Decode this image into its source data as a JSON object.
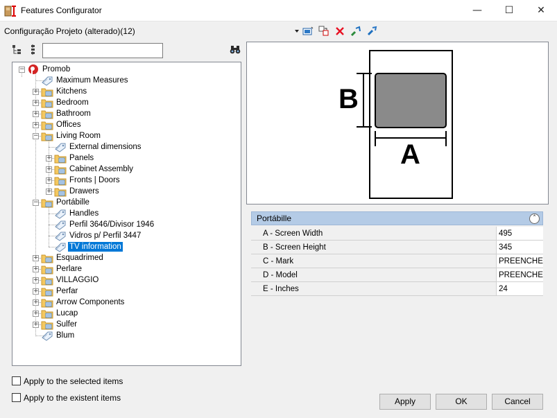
{
  "window": {
    "title": "Features Configurator",
    "minimize": "—",
    "maximize": "☐",
    "close": "✕"
  },
  "config": {
    "label": "Configuração Projeto (alterado)(12)"
  },
  "search": {
    "value": "",
    "placeholder": ""
  },
  "tree": [
    {
      "label": "Promob",
      "level": 0,
      "exp": "-",
      "icon": "promob-logo-icon"
    },
    {
      "label": "Maximum Measures",
      "level": 1,
      "icon": "tag-icon"
    },
    {
      "label": "Kitchens",
      "level": 1,
      "exp": "+",
      "icon": "folder-icon"
    },
    {
      "label": "Bedroom",
      "level": 1,
      "exp": "+",
      "icon": "folder-icon"
    },
    {
      "label": "Bathroom",
      "level": 1,
      "exp": "+",
      "icon": "folder-icon"
    },
    {
      "label": "Offices",
      "level": 1,
      "exp": "+",
      "icon": "folder-icon"
    },
    {
      "label": "Living Room",
      "level": 1,
      "exp": "-",
      "icon": "folder-icon"
    },
    {
      "label": "External dimensions",
      "level": 2,
      "icon": "tag-icon"
    },
    {
      "label": "Panels",
      "level": 2,
      "exp": "+",
      "icon": "folder-icon"
    },
    {
      "label": "Cabinet Assembly",
      "level": 2,
      "exp": "+",
      "icon": "folder-icon"
    },
    {
      "label": "Fronts | Doors",
      "level": 2,
      "exp": "+",
      "icon": "folder-icon"
    },
    {
      "label": "Drawers",
      "level": 2,
      "exp": "+",
      "icon": "folder-icon"
    },
    {
      "label": "Portábille",
      "level": 1,
      "exp": "-",
      "icon": "folder-icon"
    },
    {
      "label": "Handles",
      "level": 2,
      "icon": "tag-icon"
    },
    {
      "label": "Perfil 3646/Divisor 1946",
      "level": 2,
      "icon": "tag-icon"
    },
    {
      "label": "Vidros p/ Perfil 3447",
      "level": 2,
      "icon": "tag-icon"
    },
    {
      "label": "TV information",
      "level": 2,
      "icon": "tag-icon",
      "selected": true
    },
    {
      "label": "Esquadrimed",
      "level": 1,
      "exp": "+",
      "icon": "folder-icon"
    },
    {
      "label": "Perlare",
      "level": 1,
      "exp": "+",
      "icon": "folder-icon"
    },
    {
      "label": "VILLAGGIO",
      "level": 1,
      "exp": "+",
      "icon": "folder-icon"
    },
    {
      "label": "Perfar",
      "level": 1,
      "exp": "+",
      "icon": "folder-icon"
    },
    {
      "label": "Arrow Components",
      "level": 1,
      "exp": "+",
      "icon": "folder-icon"
    },
    {
      "label": "Lucap",
      "level": 1,
      "exp": "+",
      "icon": "folder-icon"
    },
    {
      "label": "Sulfer",
      "level": 1,
      "exp": "+",
      "icon": "folder-icon"
    },
    {
      "label": "Blum",
      "level": 1,
      "icon": "tag-icon"
    }
  ],
  "preview": {
    "label_a": "A",
    "label_b": "B"
  },
  "grid": {
    "title": "Portábille",
    "rows": [
      {
        "name": "A -  Screen Width",
        "value": "495"
      },
      {
        "name": "B -  Screen Height",
        "value": "345"
      },
      {
        "name": "C -  Mark",
        "value": "PREENCHER"
      },
      {
        "name": "D -  Model",
        "value": "PREENCHER"
      },
      {
        "name": "E -  Inches",
        "value": "24"
      }
    ]
  },
  "options": {
    "apply_selected": "Apply to the selected items",
    "apply_existent": "Apply to the existent items"
  },
  "buttons": {
    "apply": "Apply",
    "ok": "OK",
    "cancel": "Cancel"
  },
  "colors": {
    "selection": "#0078d7",
    "grid_header": "#b4cbe6",
    "delete_red": "#e81123",
    "folder": "#f4c860"
  }
}
